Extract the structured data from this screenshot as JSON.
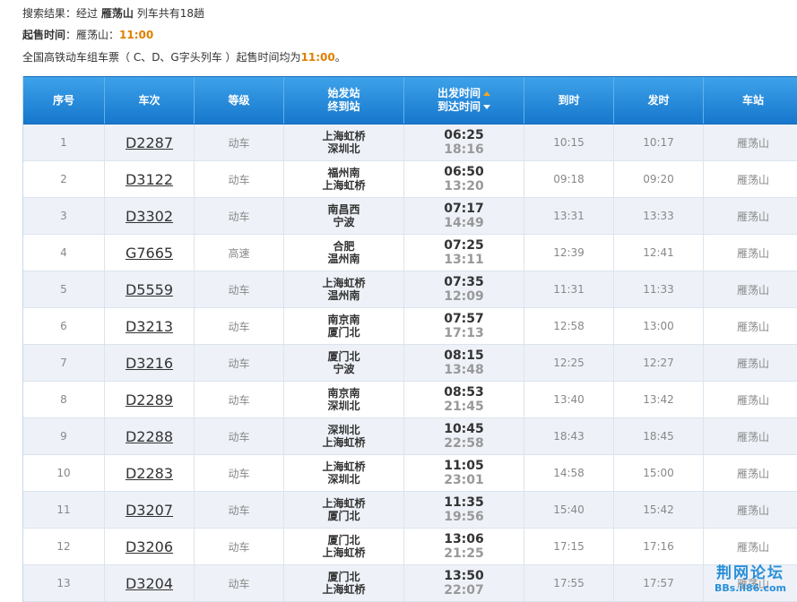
{
  "info": {
    "line1_prefix": "搜索结果：经过",
    "station": "雁荡山",
    "line1_suffix": "列车共有18趟",
    "line2_label": "起售时间",
    "line2_mid": "：雁荡山：",
    "line2_time": "11:00",
    "line3_text": "全国高铁动车组车票（ C、D、G字头列车 ）起售时间均为",
    "line3_time": "11:00",
    "line3_end": "。"
  },
  "colors": {
    "header_bg": "#1f82d6",
    "accent_orange": "#e08000",
    "row_alt": "#eef2f8"
  },
  "headers": {
    "seq": "序号",
    "train": "车次",
    "grade": "等级",
    "stations_line1": "始发站",
    "stations_line2": "终到站",
    "times_line1": "出发时间",
    "times_line2": "到达时间",
    "arrive": "到时",
    "depart": "发时",
    "station": "车站"
  },
  "rows": [
    {
      "seq": "1",
      "train": "D2287",
      "grade": "动车",
      "from": "上海虹桥",
      "to": "深圳北",
      "dep": "06:25",
      "arr": "18:16",
      "arrive_at": "10:15",
      "depart_at": "10:17",
      "station": "雁荡山"
    },
    {
      "seq": "2",
      "train": "D3122",
      "grade": "动车",
      "from": "福州南",
      "to": "上海虹桥",
      "dep": "06:50",
      "arr": "13:20",
      "arrive_at": "09:18",
      "depart_at": "09:20",
      "station": "雁荡山"
    },
    {
      "seq": "3",
      "train": "D3302",
      "grade": "动车",
      "from": "南昌西",
      "to": "宁波",
      "dep": "07:17",
      "arr": "14:49",
      "arrive_at": "13:31",
      "depart_at": "13:33",
      "station": "雁荡山"
    },
    {
      "seq": "4",
      "train": "G7665",
      "grade": "高速",
      "from": "合肥",
      "to": "温州南",
      "dep": "07:25",
      "arr": "13:11",
      "arrive_at": "12:39",
      "depart_at": "12:41",
      "station": "雁荡山"
    },
    {
      "seq": "5",
      "train": "D5559",
      "grade": "动车",
      "from": "上海虹桥",
      "to": "温州南",
      "dep": "07:35",
      "arr": "12:09",
      "arrive_at": "11:31",
      "depart_at": "11:33",
      "station": "雁荡山"
    },
    {
      "seq": "6",
      "train": "D3213",
      "grade": "动车",
      "from": "南京南",
      "to": "厦门北",
      "dep": "07:57",
      "arr": "17:13",
      "arrive_at": "12:58",
      "depart_at": "13:00",
      "station": "雁荡山"
    },
    {
      "seq": "7",
      "train": "D3216",
      "grade": "动车",
      "from": "厦门北",
      "to": "宁波",
      "dep": "08:15",
      "arr": "13:48",
      "arrive_at": "12:25",
      "depart_at": "12:27",
      "station": "雁荡山"
    },
    {
      "seq": "8",
      "train": "D2289",
      "grade": "动车",
      "from": "南京南",
      "to": "深圳北",
      "dep": "08:53",
      "arr": "21:45",
      "arrive_at": "13:40",
      "depart_at": "13:42",
      "station": "雁荡山"
    },
    {
      "seq": "9",
      "train": "D2288",
      "grade": "动车",
      "from": "深圳北",
      "to": "上海虹桥",
      "dep": "10:45",
      "arr": "22:58",
      "arrive_at": "18:43",
      "depart_at": "18:45",
      "station": "雁荡山"
    },
    {
      "seq": "10",
      "train": "D2283",
      "grade": "动车",
      "from": "上海虹桥",
      "to": "深圳北",
      "dep": "11:05",
      "arr": "23:01",
      "arrive_at": "14:58",
      "depart_at": "15:00",
      "station": "雁荡山"
    },
    {
      "seq": "11",
      "train": "D3207",
      "grade": "动车",
      "from": "上海虹桥",
      "to": "厦门北",
      "dep": "11:35",
      "arr": "19:56",
      "arrive_at": "15:40",
      "depart_at": "15:42",
      "station": "雁荡山"
    },
    {
      "seq": "12",
      "train": "D3206",
      "grade": "动车",
      "from": "厦门北",
      "to": "上海虹桥",
      "dep": "13:06",
      "arr": "21:25",
      "arrive_at": "17:15",
      "depart_at": "17:16",
      "station": "雁荡山"
    },
    {
      "seq": "13",
      "train": "D3204",
      "grade": "动车",
      "from": "厦门北",
      "to": "上海虹桥",
      "dep": "13:50",
      "arr": "22:07",
      "arrive_at": "17:55",
      "depart_at": "17:57",
      "station": "雁荡山"
    }
  ],
  "watermark": {
    "main": "荆网论坛",
    "sub": "BBs.ii86.com"
  }
}
